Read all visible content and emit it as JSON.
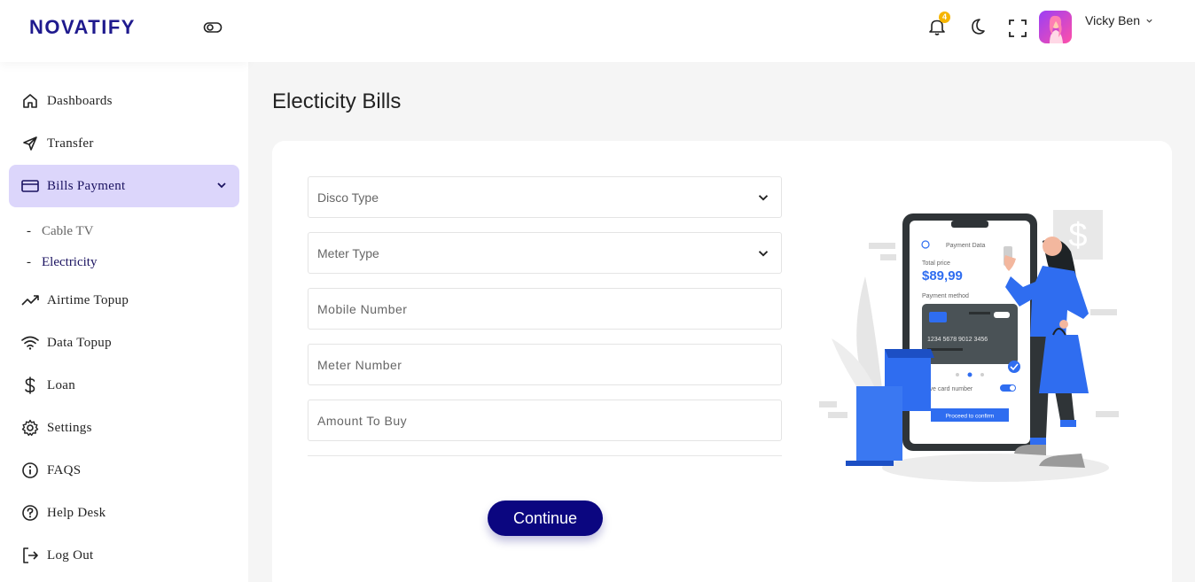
{
  "brand": {
    "logo_text_a": "N",
    "logo_text_b": "OVATIFY"
  },
  "sidebar": {
    "items": [
      {
        "label": "Dashboards",
        "icon": "home-icon"
      },
      {
        "label": "Transfer",
        "icon": "send-icon"
      },
      {
        "label": "Bills Payment",
        "icon": "card-icon",
        "active": true
      },
      {
        "label": "Airtime Topup",
        "icon": "trend-icon"
      },
      {
        "label": "Data Topup",
        "icon": "wifi-icon"
      },
      {
        "label": "Loan",
        "icon": "dollar-icon"
      },
      {
        "label": "Settings",
        "icon": "gear-icon"
      },
      {
        "label": "FAQS",
        "icon": "info-icon"
      },
      {
        "label": "Help Desk",
        "icon": "question-icon"
      },
      {
        "label": "Log Out",
        "icon": "logout-icon"
      }
    ],
    "subitems": [
      {
        "dash": "-",
        "label": "Cable TV"
      },
      {
        "dash": "-",
        "label": "Electricity"
      }
    ]
  },
  "header": {
    "notification_count": "4",
    "user_name": "Vicky Ben"
  },
  "main": {
    "title": "Electicity Bills",
    "form": {
      "disco_type": "Disco Type",
      "meter_type": "Meter Type",
      "mobile_number": "Mobile Number",
      "meter_number": "Meter Number",
      "amount_to_buy": "Amount To Buy",
      "continue_label": "Continue"
    },
    "illustration": {
      "header": "Payment Data",
      "total_label": "Total price",
      "total_value": "$89,99",
      "method_label": "Payment method",
      "card_number": "1234  5678  9012  3456",
      "save_label": "Save card number",
      "confirm_label": "Proceed to confirm"
    }
  },
  "colors": {
    "accent": "#0b0680",
    "active_bg": "#dcd6fb",
    "illustration_blue": "#2f6df0"
  }
}
